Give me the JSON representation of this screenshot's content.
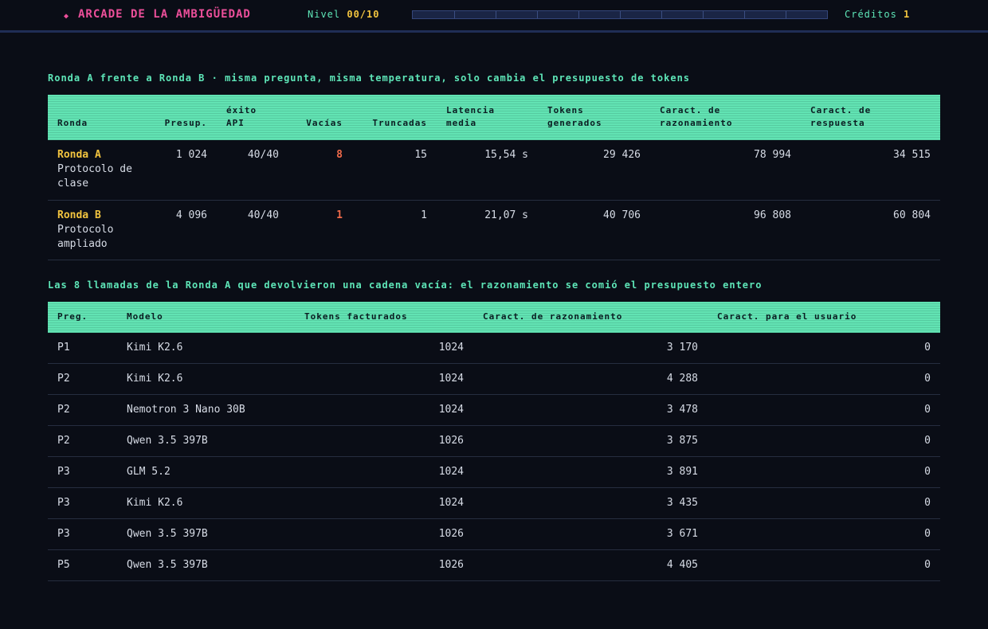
{
  "header": {
    "title": "ARCADE DE LA AMBIGÜEDAD",
    "level_label": "Nivel",
    "level_value": "00/10",
    "progress": 0,
    "credits_label": "Créditos",
    "credits_value": "1",
    "colors": {
      "accent_pink": "#ec4f9a",
      "accent_green": "#5ee6b8",
      "accent_yellow": "#f2c43f"
    }
  },
  "section1": {
    "caption": "Ronda A frente a Ronda B · misma pregunta, misma temperatura, solo cambia el presupuesto de tokens",
    "headers": [
      "Ronda",
      "Presup.",
      "éxito\nAPI",
      "Vacías",
      "Truncadas",
      "Latencia\nmedia",
      "Tokens\ngenerados",
      "Caract. de\nrazonamiento",
      "Caract. de\nrespuesta"
    ],
    "rows": [
      {
        "name": "Ronda A",
        "desc": "Protocolo de clase",
        "budget": "1 024",
        "api_ok": "40/40",
        "empty": "8",
        "truncated": "15",
        "latency": "15,54 s",
        "tokens": "29 426",
        "reasoning_chars": "78 994",
        "answer_chars": "34 515"
      },
      {
        "name": "Ronda B",
        "desc": "Protocolo ampliado",
        "budget": "4 096",
        "api_ok": "40/40",
        "empty": "1",
        "truncated": "1",
        "latency": "21,07 s",
        "tokens": "40 706",
        "reasoning_chars": "96 808",
        "answer_chars": "60 804"
      }
    ]
  },
  "section2": {
    "caption": "Las 8 llamadas de la Ronda A que devolvieron una cadena vacía: el razonamiento se comió el presupuesto entero",
    "headers": [
      "Preg.",
      "Modelo",
      "Tokens facturados",
      "Caract. de razonamiento",
      "Caract. para el usuario"
    ],
    "rows": [
      {
        "q": "P1",
        "model": "Kimi K2.6",
        "tokens": "1024",
        "reasoning": "3 170",
        "user": "0"
      },
      {
        "q": "P2",
        "model": "Kimi K2.6",
        "tokens": "1024",
        "reasoning": "4 288",
        "user": "0"
      },
      {
        "q": "P2",
        "model": "Nemotron 3 Nano 30B",
        "tokens": "1024",
        "reasoning": "3 478",
        "user": "0"
      },
      {
        "q": "P2",
        "model": "Qwen 3.5 397B",
        "tokens": "1026",
        "reasoning": "3 875",
        "user": "0"
      },
      {
        "q": "P3",
        "model": "GLM 5.2",
        "tokens": "1024",
        "reasoning": "3 891",
        "user": "0"
      },
      {
        "q": "P3",
        "model": "Kimi K2.6",
        "tokens": "1024",
        "reasoning": "3 435",
        "user": "0"
      },
      {
        "q": "P3",
        "model": "Qwen 3.5 397B",
        "tokens": "1026",
        "reasoning": "3 671",
        "user": "0"
      },
      {
        "q": "P5",
        "model": "Qwen 3.5 397B",
        "tokens": "1026",
        "reasoning": "4 405",
        "user": "0"
      }
    ]
  }
}
